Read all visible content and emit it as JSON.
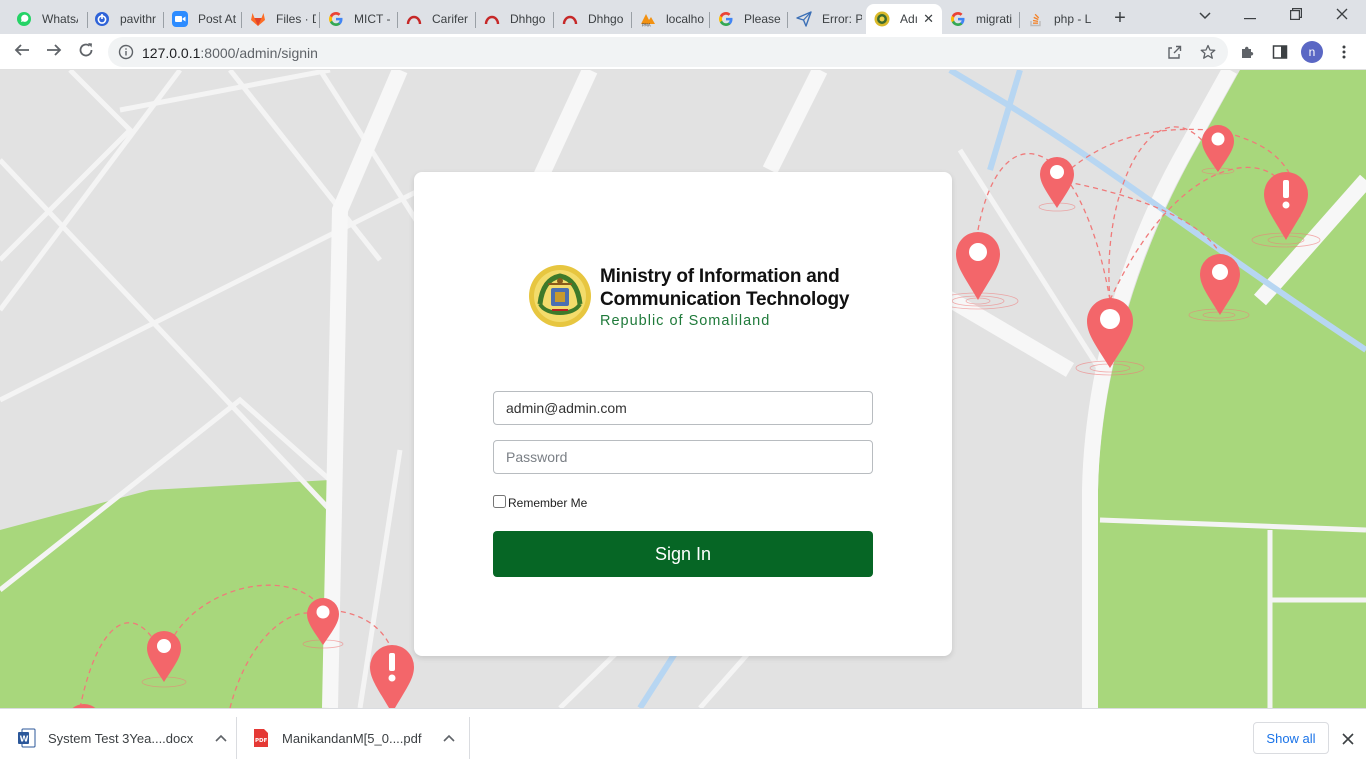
{
  "browser": {
    "tabs": [
      {
        "title": "WhatsA",
        "icon": "whatsapp-icon"
      },
      {
        "title": "pavithr",
        "icon": "power-icon"
      },
      {
        "title": "Post At",
        "icon": "zoom-icon"
      },
      {
        "title": "Files · D",
        "icon": "gitlab-icon"
      },
      {
        "title": "MICT -",
        "icon": "google-icon"
      },
      {
        "title": "Carifer",
        "icon": "arch-icon"
      },
      {
        "title": "Dhhgo",
        "icon": "arch-icon"
      },
      {
        "title": "Dhhgo",
        "icon": "arch-icon"
      },
      {
        "title": "localho",
        "icon": "phpmyadmin-icon"
      },
      {
        "title": "Please",
        "icon": "google-icon"
      },
      {
        "title": "Error: P",
        "icon": "send-icon"
      },
      {
        "title": "Adı",
        "icon": "seal-icon",
        "active": true
      },
      {
        "title": "migrati",
        "icon": "google-icon"
      },
      {
        "title": "php - L",
        "icon": "stackoverflow-icon"
      }
    ],
    "address": {
      "host": "127.0.0.1",
      "path": ":8000/admin/signin"
    },
    "profile_initial": "n"
  },
  "login": {
    "logo_line1": "Ministry of Information  and",
    "logo_line2": "Communication Technology",
    "logo_line3": "Republic of Somaliland",
    "email_value": "admin@admin.com",
    "password_placeholder": "Password",
    "remember_label": "Remember Me",
    "signin_label": "Sign In"
  },
  "downloads": {
    "items": [
      {
        "name": "System Test 3Yea....docx",
        "type": "word-icon"
      },
      {
        "name": "ManikandanM[5_0....pdf",
        "type": "pdf-icon"
      }
    ],
    "show_all": "Show all"
  },
  "colors": {
    "signin_button": "#066625",
    "logo_subtitle": "#1f7a3a",
    "map_pin": "#f3666a",
    "map_park": "#a8d77c",
    "link_blue": "#1a73e8"
  }
}
